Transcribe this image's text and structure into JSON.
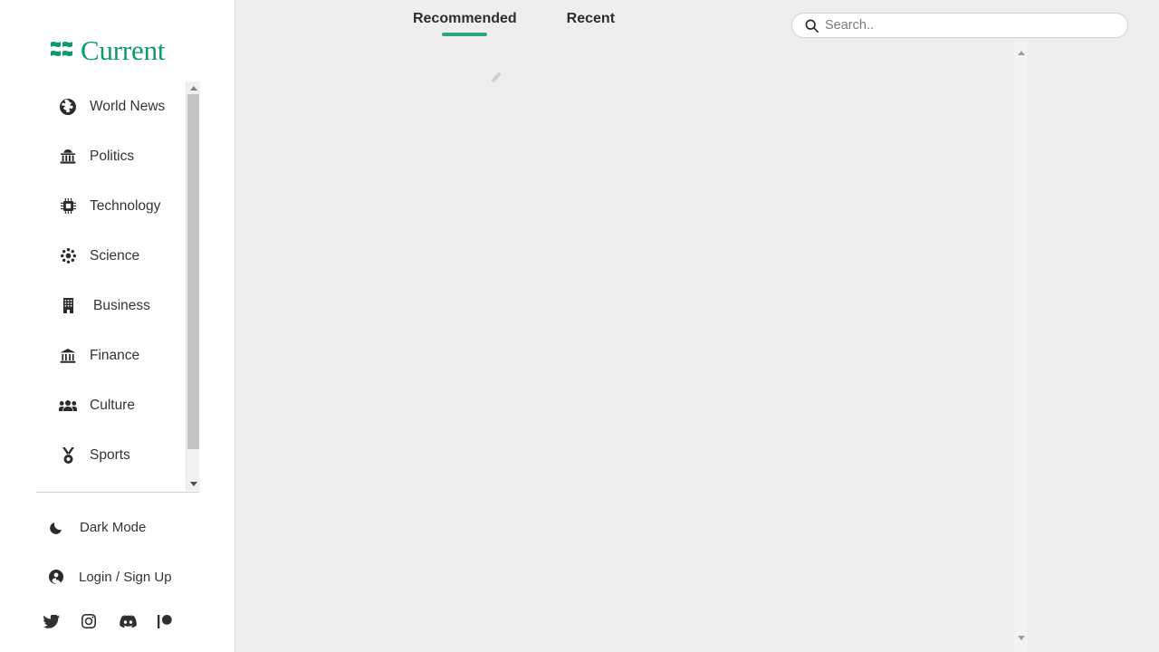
{
  "brand": {
    "name": "Current",
    "mark_icon": "waves-logo-icon",
    "accent_color": "#0c9b6c"
  },
  "sidebar": {
    "nav_items": [
      {
        "label": "World News",
        "icon": "globe-icon"
      },
      {
        "label": "Politics",
        "icon": "landmark-dome-icon"
      },
      {
        "label": "Technology",
        "icon": "microchip-icon"
      },
      {
        "label": "Science",
        "icon": "atom-icon"
      },
      {
        "label": "Business",
        "icon": "office-building-icon"
      },
      {
        "label": "Finance",
        "icon": "bank-columns-icon"
      },
      {
        "label": "Culture",
        "icon": "people-group-icon"
      },
      {
        "label": "Sports",
        "icon": "medal-icon"
      }
    ],
    "actions": [
      {
        "label": "Dark Mode",
        "icon": "moon-icon"
      },
      {
        "label": "Login / Sign Up",
        "icon": "user-circle-icon"
      }
    ],
    "socials": [
      {
        "name": "twitter-icon"
      },
      {
        "name": "instagram-icon"
      },
      {
        "name": "discord-icon"
      },
      {
        "name": "patreon-icon"
      }
    ],
    "scrollbar": {
      "up_arrow_icon": "scroll-up-arrow-icon",
      "down_arrow_icon": "scroll-down-arrow-icon"
    }
  },
  "main": {
    "tabs": [
      {
        "label": "Recommended",
        "active": true
      },
      {
        "label": "Recent",
        "active": false
      }
    ],
    "active_tab_underline_color": "#2ea683",
    "feed": {
      "state": "loading",
      "spinner_icon": "loading-spinner-icon",
      "articles": []
    },
    "feed_scrollbar": {
      "up_arrow_icon": "scroll-up-arrow-icon",
      "down_arrow_icon": "scroll-down-arrow-icon"
    }
  },
  "search": {
    "icon": "search-icon",
    "placeholder": "Search..",
    "value": ""
  }
}
